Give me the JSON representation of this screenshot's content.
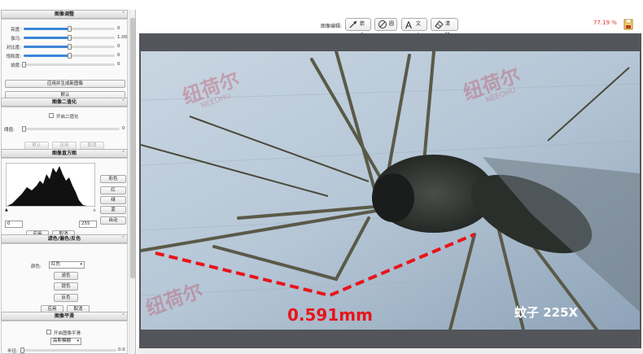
{
  "adjust": {
    "title": "图像调整",
    "rows": [
      {
        "label": "亮度:",
        "value": "0",
        "level": 0.5
      },
      {
        "label": "伽马:",
        "value": "1.00",
        "level": 0.5
      },
      {
        "label": "对比度:",
        "value": "0",
        "level": 0.5
      },
      {
        "label": "饱和度:",
        "value": "0",
        "level": 0.5
      },
      {
        "label": "锐度:",
        "value": "0",
        "level": 0.0
      }
    ],
    "apply_new_label": "应用并生成新图像",
    "default_label": "默认"
  },
  "binarize": {
    "title": "图像二值化",
    "enable_label": "开启二值化",
    "threshold_label": "阈值:",
    "threshold_value": "0",
    "buttons": [
      "默认",
      "应用",
      "取消"
    ]
  },
  "histogram": {
    "title": "图像直方图",
    "channels": [
      "彩色",
      "红",
      "绿",
      "蓝",
      "自动"
    ],
    "min_value": "0",
    "max_value": "255",
    "apply_label": "应用",
    "cancel_label": "取消"
  },
  "filter": {
    "title": "滤色/偏色/反色",
    "color_label": "颜色:",
    "color_value": "红色",
    "filter_label": "滤色",
    "tint_label": "提色",
    "invert_label": "反色",
    "apply_label": "应用",
    "cancel_label": "取消"
  },
  "smooth": {
    "title": "图像平滑",
    "enable_label": "开启图像平滑",
    "method_value": "高斯模糊",
    "radius_label": "半径:",
    "radius_value": "0.0"
  },
  "toolbar": {
    "edit_label": "图像编辑:",
    "arrow_label": "箭头",
    "circle_label": "圆",
    "text_label": "文本",
    "clear_label": "清除",
    "zoom": "77.19 %"
  },
  "image": {
    "measurement": "0.591mm",
    "caption": "蚊子 225X",
    "watermark_cn": "纽荷尔",
    "watermark_en": "NEEOHU",
    "colors": {
      "measure": "#e8141a",
      "accent": "#3b86d6"
    }
  }
}
